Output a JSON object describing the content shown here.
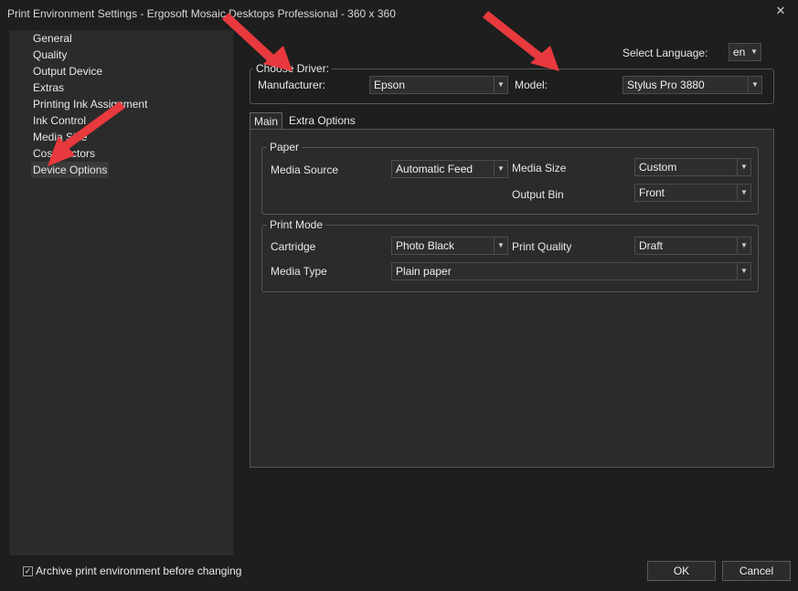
{
  "window": {
    "title": "Print Environment Settings - Ergosoft Mosaic Desktops Professional - 360 x 360",
    "close_glyph": "✕"
  },
  "sidebar": {
    "items": [
      {
        "label": "General"
      },
      {
        "label": "Quality"
      },
      {
        "label": "Output Device"
      },
      {
        "label": "Extras"
      },
      {
        "label": "Printing Ink Assignment"
      },
      {
        "label": "Ink Control"
      },
      {
        "label": "Media Size"
      },
      {
        "label": "Cost Factors"
      },
      {
        "label": "Device Options",
        "selected": true
      }
    ]
  },
  "language": {
    "label": "Select Language:",
    "value": "en"
  },
  "driver": {
    "group_title": "Choose Driver:",
    "manufacturer_label": "Manufacturer:",
    "manufacturer_value": "Epson",
    "model_label": "Model:",
    "model_value": "Stylus Pro 3880"
  },
  "tabs": [
    {
      "label": "Main",
      "active": true
    },
    {
      "label": "Extra Options",
      "active": false
    }
  ],
  "paper": {
    "group_title": "Paper",
    "media_source_label": "Media Source",
    "media_source_value": "Automatic Feed",
    "media_size_label": "Media Size",
    "media_size_value": "Custom",
    "output_bin_label": "Output Bin",
    "output_bin_value": "Front"
  },
  "print_mode": {
    "group_title": "Print Mode",
    "cartridge_label": "Cartridge",
    "cartridge_value": "Photo Black",
    "print_quality_label": "Print Quality",
    "print_quality_value": "Draft",
    "media_type_label": "Media Type",
    "media_type_value": "Plain paper"
  },
  "footer": {
    "archive_label": "Archive print environment before changing",
    "archive_checked": true,
    "ok_label": "OK",
    "cancel_label": "Cancel"
  },
  "colors": {
    "background": "#1e1e1e",
    "panel": "#2b2b2b",
    "annotation_arrow": "#e8393e"
  },
  "dropdown_arrow_glyph": "▼",
  "check_glyph": "✓"
}
